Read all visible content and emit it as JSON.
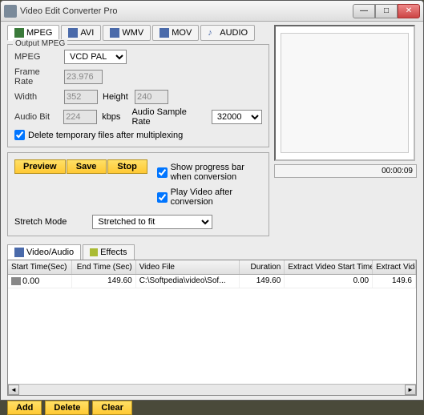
{
  "window": {
    "title": "Video Edit Converter Pro"
  },
  "formatTabs": [
    "MPEG",
    "AVI",
    "WMV",
    "MOV",
    "AUDIO"
  ],
  "output": {
    "groupTitle": "Output MPEG",
    "mpegLabel": "MPEG",
    "mpegValue": "VCD PAL",
    "frameRateLabel": "Frame Rate",
    "frameRateValue": "23.976",
    "widthLabel": "Width",
    "widthValue": "352",
    "heightLabel": "Height",
    "heightValue": "240",
    "audioBitLabel": "Audio Bit",
    "audioBitValue": "224",
    "kbpsLabel": "kbps",
    "audioSampleLabel": "Audio Sample Rate",
    "audioSampleValue": "32000",
    "deleteTempLabel": "Delete temporary files after multiplexing"
  },
  "actions": {
    "preview": "Preview",
    "save": "Save",
    "stop": "Stop",
    "showProgress": "Show progress bar when conversion",
    "playAfter": "Play Video after conversion",
    "stretchLabel": "Stretch Mode",
    "stretchValue": "Stretched to fit"
  },
  "preview": {
    "timer": "00:00:09"
  },
  "subtabs": {
    "va": "Video/Audio",
    "fx": "Effects"
  },
  "grid": {
    "headers": [
      "Start Time(Sec)",
      "End Time (Sec)",
      "Video File",
      "Duration",
      "Extract Video Start Time",
      "Extract Video End Tim"
    ],
    "row": {
      "start": "0.00",
      "end": "149.60",
      "file": "C:\\Softpedia\\video\\Sof...",
      "duration": "149.60",
      "exStart": "0.00",
      "exEnd": "149.6"
    }
  },
  "bottom": {
    "add": "Add",
    "delete": "Delete",
    "clear": "Clear"
  },
  "scroll": {
    "left": "◄",
    "right": "►"
  }
}
